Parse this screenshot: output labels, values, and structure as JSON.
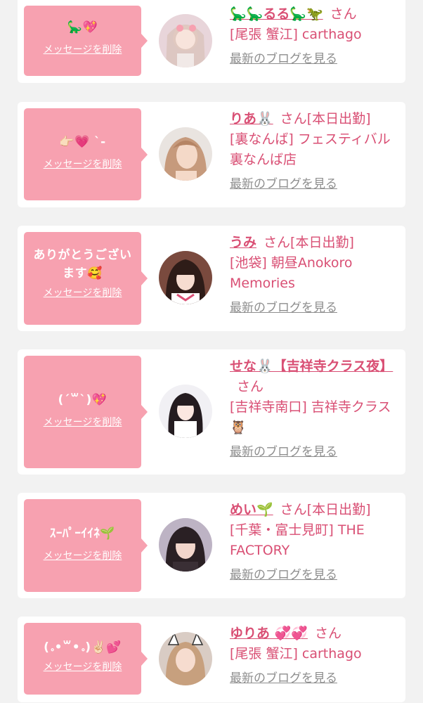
{
  "colors": {
    "accent": "#d94f74",
    "bubble": "#f7a1b0",
    "background": "#f2f2f2",
    "muted": "#8e8e8e"
  },
  "entries": [
    {
      "message": "🦕💖",
      "delete_label": "メッセージを削除",
      "name": "🦕🦕るる🦕🦖",
      "honorific": "さん",
      "status": "",
      "shop": "[尾張 蟹江] carthago",
      "blog_link": "最新のブログを見る"
    },
    {
      "message": "👉🏻💗 ˋ-",
      "delete_label": "メッセージを削除",
      "name": "りあ🐰",
      "honorific": "さん",
      "status": "[本日出勤]",
      "shop": "[裏なんば] フェスティバル 裏なんば店",
      "blog_link": "最新のブログを見る"
    },
    {
      "message": "ありがとうございます🥰",
      "delete_label": "メッセージを削除",
      "name": "うみ",
      "honorific": "さん",
      "status": "[本日出勤]",
      "shop": "[池袋] 朝昼Anokoro Memories",
      "blog_link": "最新のブログを見る"
    },
    {
      "message": "(ˊ꒳ˋ)💖",
      "delete_label": "メッセージを削除",
      "name": "せな🐰【吉祥寺クラス夜】",
      "honorific": "さん",
      "status": "",
      "shop": "[吉祥寺南口] 吉祥寺クラス🦉",
      "blog_link": "最新のブログを見る"
    },
    {
      "message": "ｽｰﾊﾟｰｲｲﾈ🌱",
      "delete_label": "メッセージを削除",
      "name": "めい🌱",
      "honorific": "さん",
      "status": "[本日出勤]",
      "shop": "[千葉・富士見町] THE FACTORY",
      "blog_link": "最新のブログを見る"
    },
    {
      "message": "(｡•꒳•｡)✌🏻💕",
      "delete_label": "メッセージを削除",
      "name": "ゆりあ 💞💞",
      "honorific": "さん",
      "status": "",
      "shop": "[尾張 蟹江] carthago",
      "blog_link": "最新のブログを見る"
    }
  ]
}
